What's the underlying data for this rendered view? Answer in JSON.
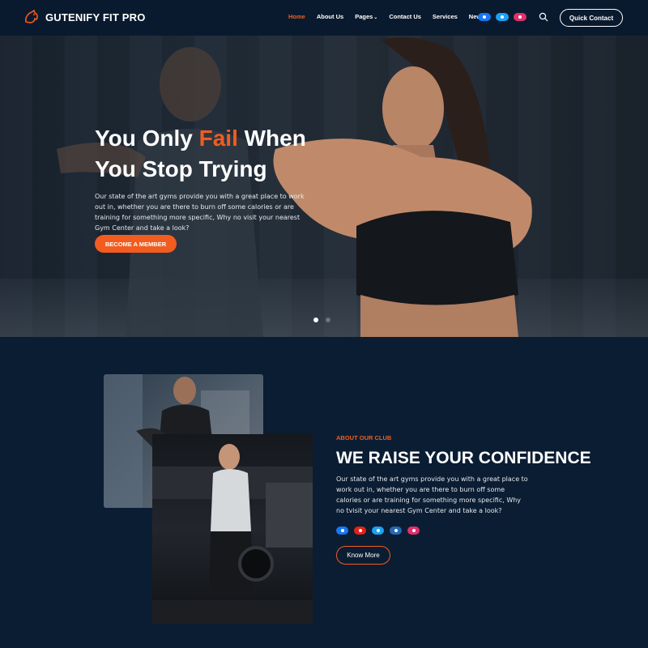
{
  "header": {
    "logo_text": "GUTENIFY FIT PRO",
    "nav": [
      {
        "label": "Home",
        "active": true
      },
      {
        "label": "About Us",
        "active": false
      },
      {
        "label": "Pages",
        "active": false,
        "dropdown": true
      },
      {
        "label": "Contact Us",
        "active": false
      },
      {
        "label": "Services",
        "active": false
      },
      {
        "label": "News",
        "active": false
      }
    ],
    "socials": [
      {
        "icon": "facebook-icon",
        "color": "#1877f2"
      },
      {
        "icon": "twitter-icon",
        "color": "#1da1f2"
      },
      {
        "icon": "instagram-icon",
        "color": "#e1306c"
      }
    ],
    "search_icon": "search-icon",
    "cta_label": "Quick Contact"
  },
  "hero": {
    "title_line1_pre": "You Only ",
    "title_line1_accent": "Fail",
    "title_line1_post": " When",
    "title_line2": "You Stop Trying",
    "description": "Our state of the art gyms provide you with a great place to work out in, whether you are there to burn off some calories or are training for something more specific, Why no visit your nearest Gym Center and take a look?",
    "button_label": "BECOME A MEMBER",
    "slides": 2,
    "active_slide": 1
  },
  "about": {
    "label": "ABOUT OUR CLUB",
    "title": "WE RAISE YOUR CONFIDENCE",
    "description": "Our state of the art gyms provide you with a great place to work out in, whether you are there to burn off some calories or are training for something more specific, Why no tvisit your nearest Gym Center and take a look?",
    "socials": [
      {
        "icon": "facebook-icon",
        "color": "#1877f2"
      },
      {
        "icon": "youtube-icon",
        "color": "#e62117"
      },
      {
        "icon": "twitter-icon",
        "color": "#1da1f2"
      },
      {
        "icon": "linkedin-icon",
        "color": "#2867b2"
      },
      {
        "icon": "instagram-icon",
        "color": "#e1306c"
      }
    ],
    "button_label": "Know More"
  },
  "colors": {
    "accent": "#f25c1f",
    "background": "#0b1d33",
    "header_bg": "#0a1a2e"
  }
}
